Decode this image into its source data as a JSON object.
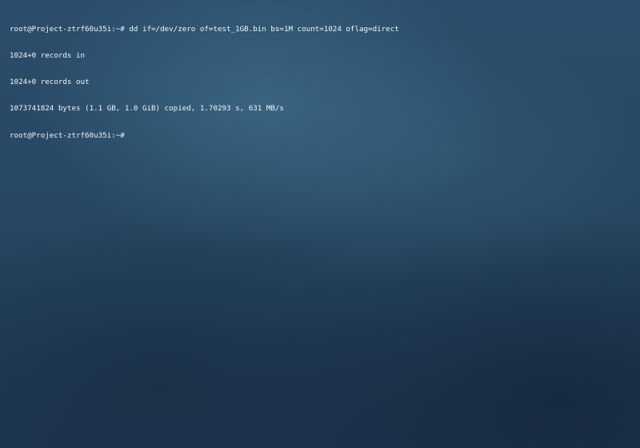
{
  "terminal": {
    "lines": [
      "root@Project-ztrf60u35i:~# dd if=/dev/zero of=test_1GB.bin bs=1M count=1024 oflag=direct",
      "1024+0 records in",
      "1024+0 records out",
      "1073741824 bytes (1.1 GB, 1.0 GiB) copied, 1.70293 s, 631 MB/s",
      "root@Project-ztrf60u35i:~#"
    ]
  },
  "colors": {
    "text": "#f2f5f8",
    "background": "#264762"
  }
}
